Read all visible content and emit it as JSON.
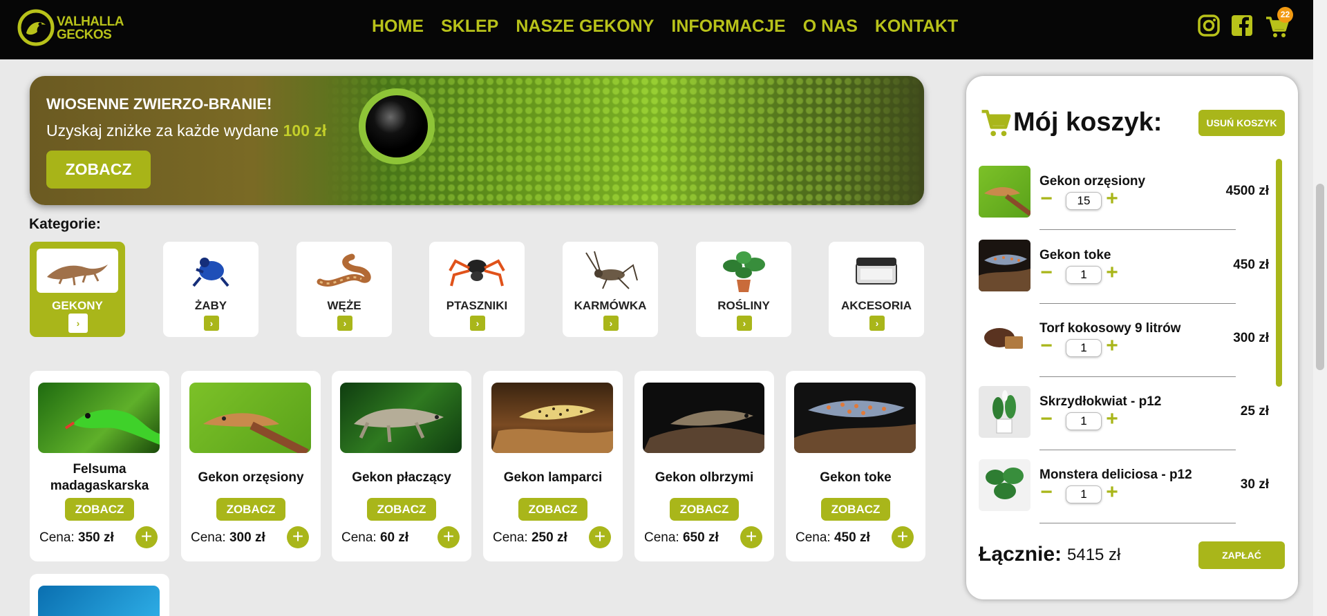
{
  "brand": {
    "line1": "VALHALLA",
    "line2": "GECKOS"
  },
  "nav": [
    "HOME",
    "SKLEP",
    "NASZE GEKONY",
    "INFORMACJE",
    "O NAS",
    "KONTAKT"
  ],
  "header": {
    "cart_count": "22",
    "icons": [
      "instagram-icon",
      "facebook-icon",
      "cart-icon"
    ]
  },
  "banner": {
    "headline": "WIOSENNE ZWIERZO-BRANIE!",
    "sub_text": "Uzyskaj zniżke za każde wydane ",
    "sub_accent": "100 zł",
    "button": "ZOBACZ"
  },
  "categories_title": "Kategorie:",
  "categories": [
    {
      "label": "GEKONY",
      "active": true
    },
    {
      "label": "ŻABY"
    },
    {
      "label": "WĘŻE"
    },
    {
      "label": "PTASZNIKI"
    },
    {
      "label": "KARMÓWKA"
    },
    {
      "label": "ROŚLINY"
    },
    {
      "label": "AKCESORIA"
    }
  ],
  "products": [
    {
      "name": "Felsuma madagaskarska",
      "button": "ZOBACZ",
      "price_label": "Cena: ",
      "price": "350 zł"
    },
    {
      "name": "Gekon orzęsiony",
      "button": "ZOBACZ",
      "price_label": "Cena: ",
      "price": "300 zł"
    },
    {
      "name": "Gekon płaczący",
      "button": "ZOBACZ",
      "price_label": "Cena: ",
      "price": "60 zł"
    },
    {
      "name": "Gekon lamparci",
      "button": "ZOBACZ",
      "price_label": "Cena: ",
      "price": "250 zł"
    },
    {
      "name": "Gekon olbrzymi",
      "button": "ZOBACZ",
      "price_label": "Cena: ",
      "price": "650 zł"
    },
    {
      "name": "Gekon toke",
      "button": "ZOBACZ",
      "price_label": "Cena: ",
      "price": "450 zł"
    }
  ],
  "cart": {
    "title": "Mój koszyk:",
    "clear_button": "USUŃ KOSZYK",
    "items": [
      {
        "name": "Gekon orzęsiony",
        "qty": "15",
        "price": "4500 zł"
      },
      {
        "name": "Gekon toke",
        "qty": "1",
        "price": "450 zł"
      },
      {
        "name": "Torf kokosowy 9 litrów",
        "qty": "1",
        "price": "300 zł"
      },
      {
        "name": "Skrzydłokwiat - p12",
        "qty": "1",
        "price": "25 zł"
      },
      {
        "name": "Monstera deliciosa - p12",
        "qty": "1",
        "price": "30 zł"
      }
    ],
    "total_label": "Łącznie:",
    "total_value": "5415 zł",
    "pay_button": "ZAPŁAĆ"
  },
  "colors": {
    "accent": "#a9b61a",
    "brand_text": "#b8c21a",
    "header_bg": "#060606",
    "badge": "#f29a12"
  }
}
